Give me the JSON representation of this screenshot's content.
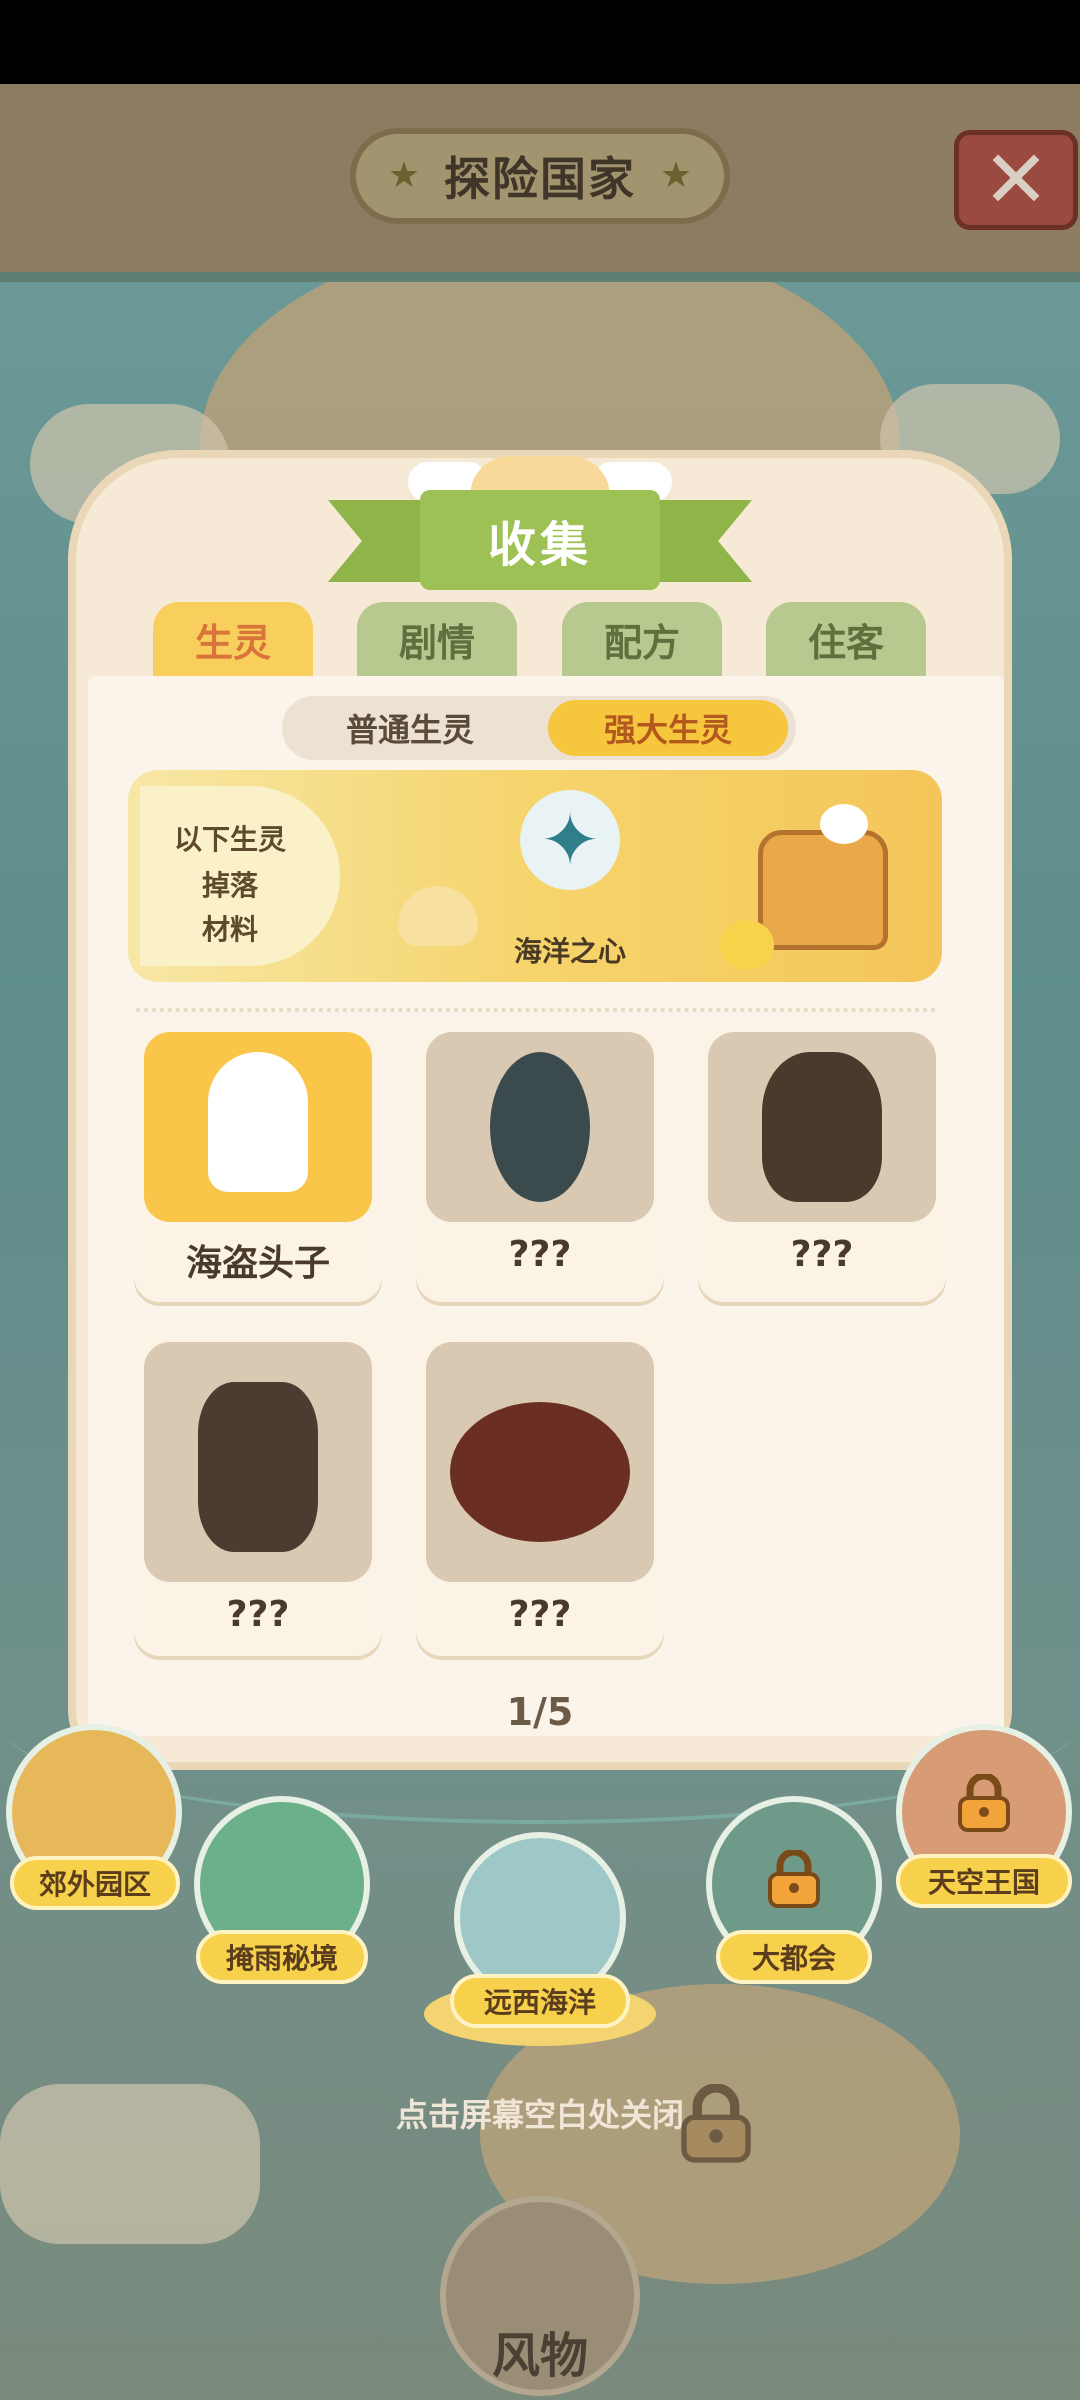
{
  "header": {
    "title": "探险国家"
  },
  "collection": {
    "title": "收集",
    "tabs": [
      {
        "label": "生灵",
        "active": true
      },
      {
        "label": "剧情",
        "active": false
      },
      {
        "label": "配方",
        "active": false
      },
      {
        "label": "住客",
        "active": false
      }
    ],
    "subtabs": [
      {
        "label": "普通生灵",
        "active": false
      },
      {
        "label": "强大生灵",
        "active": true
      }
    ],
    "banner": {
      "tag_lines": [
        "以下生灵",
        "掉落",
        "材料"
      ],
      "item_name": "海洋之心"
    },
    "creatures": [
      {
        "name": "海盗头子",
        "unlocked": true
      },
      {
        "name": "???",
        "unlocked": false
      },
      {
        "name": "???",
        "unlocked": false
      },
      {
        "name": "???",
        "unlocked": false
      },
      {
        "name": "???",
        "unlocked": false
      }
    ],
    "pager": "1/5"
  },
  "locations": [
    {
      "label": "郊外园区",
      "locked": false
    },
    {
      "label": "掩雨秘境",
      "locked": false
    },
    {
      "label": "远西海洋",
      "locked": false,
      "selected": true
    },
    {
      "label": "大都会",
      "locked": true
    },
    {
      "label": "天空王国",
      "locked": true
    }
  ],
  "hint": "点击屏幕空白处关闭",
  "bottom_button": {
    "label": "风物"
  },
  "colors": {
    "accent_yellow": "#f7d14c",
    "tab_active": "#f8cf5c",
    "ribbon_green": "#8fb44a"
  }
}
